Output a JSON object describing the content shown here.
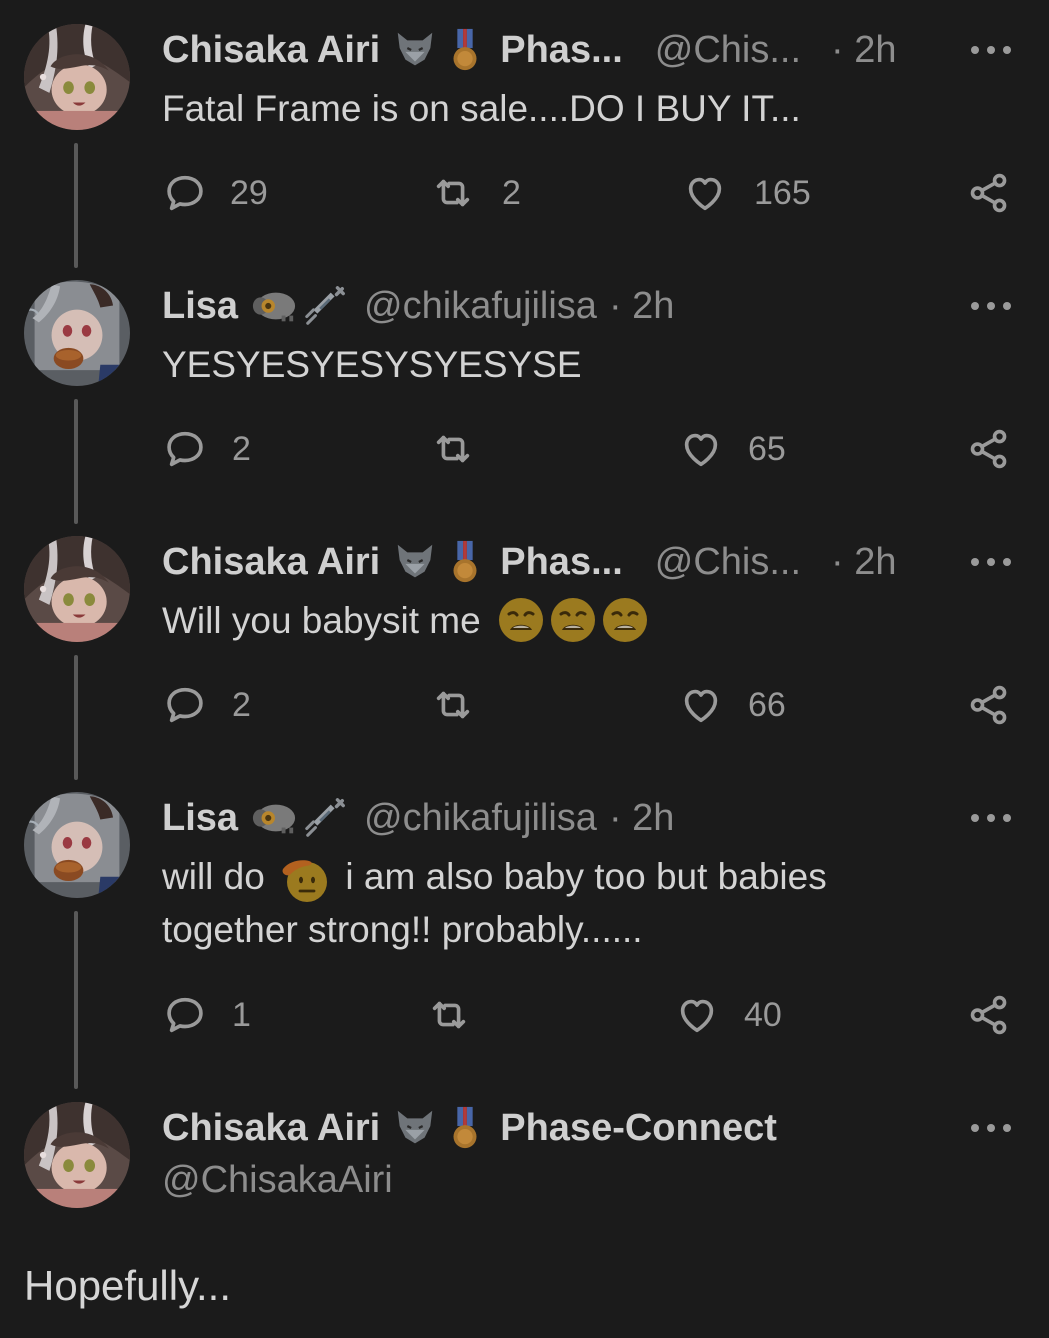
{
  "tweets": [
    {
      "author": "Chisaka Airi",
      "org": "Phas...",
      "handle": "@Chis...",
      "time": "· 2h",
      "text": "Fatal Frame is on sale....DO I BUY IT...",
      "replies": "29",
      "retweets": "2",
      "likes": "165"
    },
    {
      "author": "Lisa",
      "handle": "@chikafujilisa",
      "time": "· 2h",
      "text": "YESYESYESYSYESYSE",
      "replies": "2",
      "retweets": "",
      "likes": "65"
    },
    {
      "author": "Chisaka Airi",
      "org": "Phas...",
      "handle": "@Chis...",
      "time": "· 2h",
      "text": "Will you babysit me",
      "replies": "2",
      "retweets": "",
      "likes": "66"
    },
    {
      "author": "Lisa",
      "handle": "@chikafujilisa",
      "time": "· 2h",
      "text_a": "will do",
      "text_b": "i am also baby too but babies",
      "text_c": "together strong!! probably......",
      "replies": "1",
      "retweets": "",
      "likes": "40"
    },
    {
      "author": "Chisaka Airi",
      "org": "Phase-Connect",
      "handle": "@ChisakaAiri"
    }
  ],
  "final_text": "Hopefully...",
  "icons": {
    "reply": "reply-icon",
    "retweet": "retweet-icon",
    "like": "heart-icon",
    "share": "share-icon",
    "more": "more-icon",
    "wolf": "wolf-icon",
    "medal": "medal-icon",
    "sheep": "sheep-icon",
    "syringe": "syringe-icon",
    "weary": "weary-face-icon",
    "salute": "saluting-face-icon"
  }
}
